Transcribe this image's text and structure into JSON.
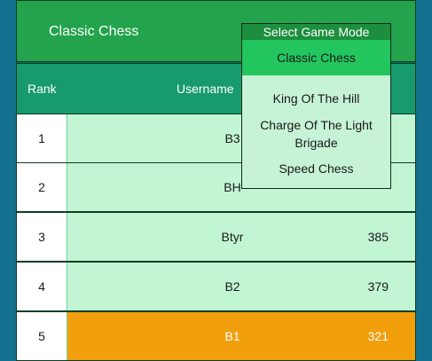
{
  "header": {
    "title": "Classic Chess"
  },
  "columns": {
    "rank": "Rank",
    "username": "Username"
  },
  "rows": [
    {
      "rank": "1",
      "username": "B3",
      "score": ""
    },
    {
      "rank": "2",
      "username": "BH",
      "score": ""
    },
    {
      "rank": "3",
      "username": "Btyr",
      "score": "385"
    },
    {
      "rank": "4",
      "username": "B2",
      "score": "379"
    },
    {
      "rank": "5",
      "username": "B1",
      "score": "321"
    }
  ],
  "dropdown": {
    "label": "Select Game Mode",
    "options": [
      "Classic Chess",
      "King Of The Hill",
      "Charge Of The Light Brigade",
      "Speed Chess"
    ],
    "selected": "Classic Chess"
  }
}
